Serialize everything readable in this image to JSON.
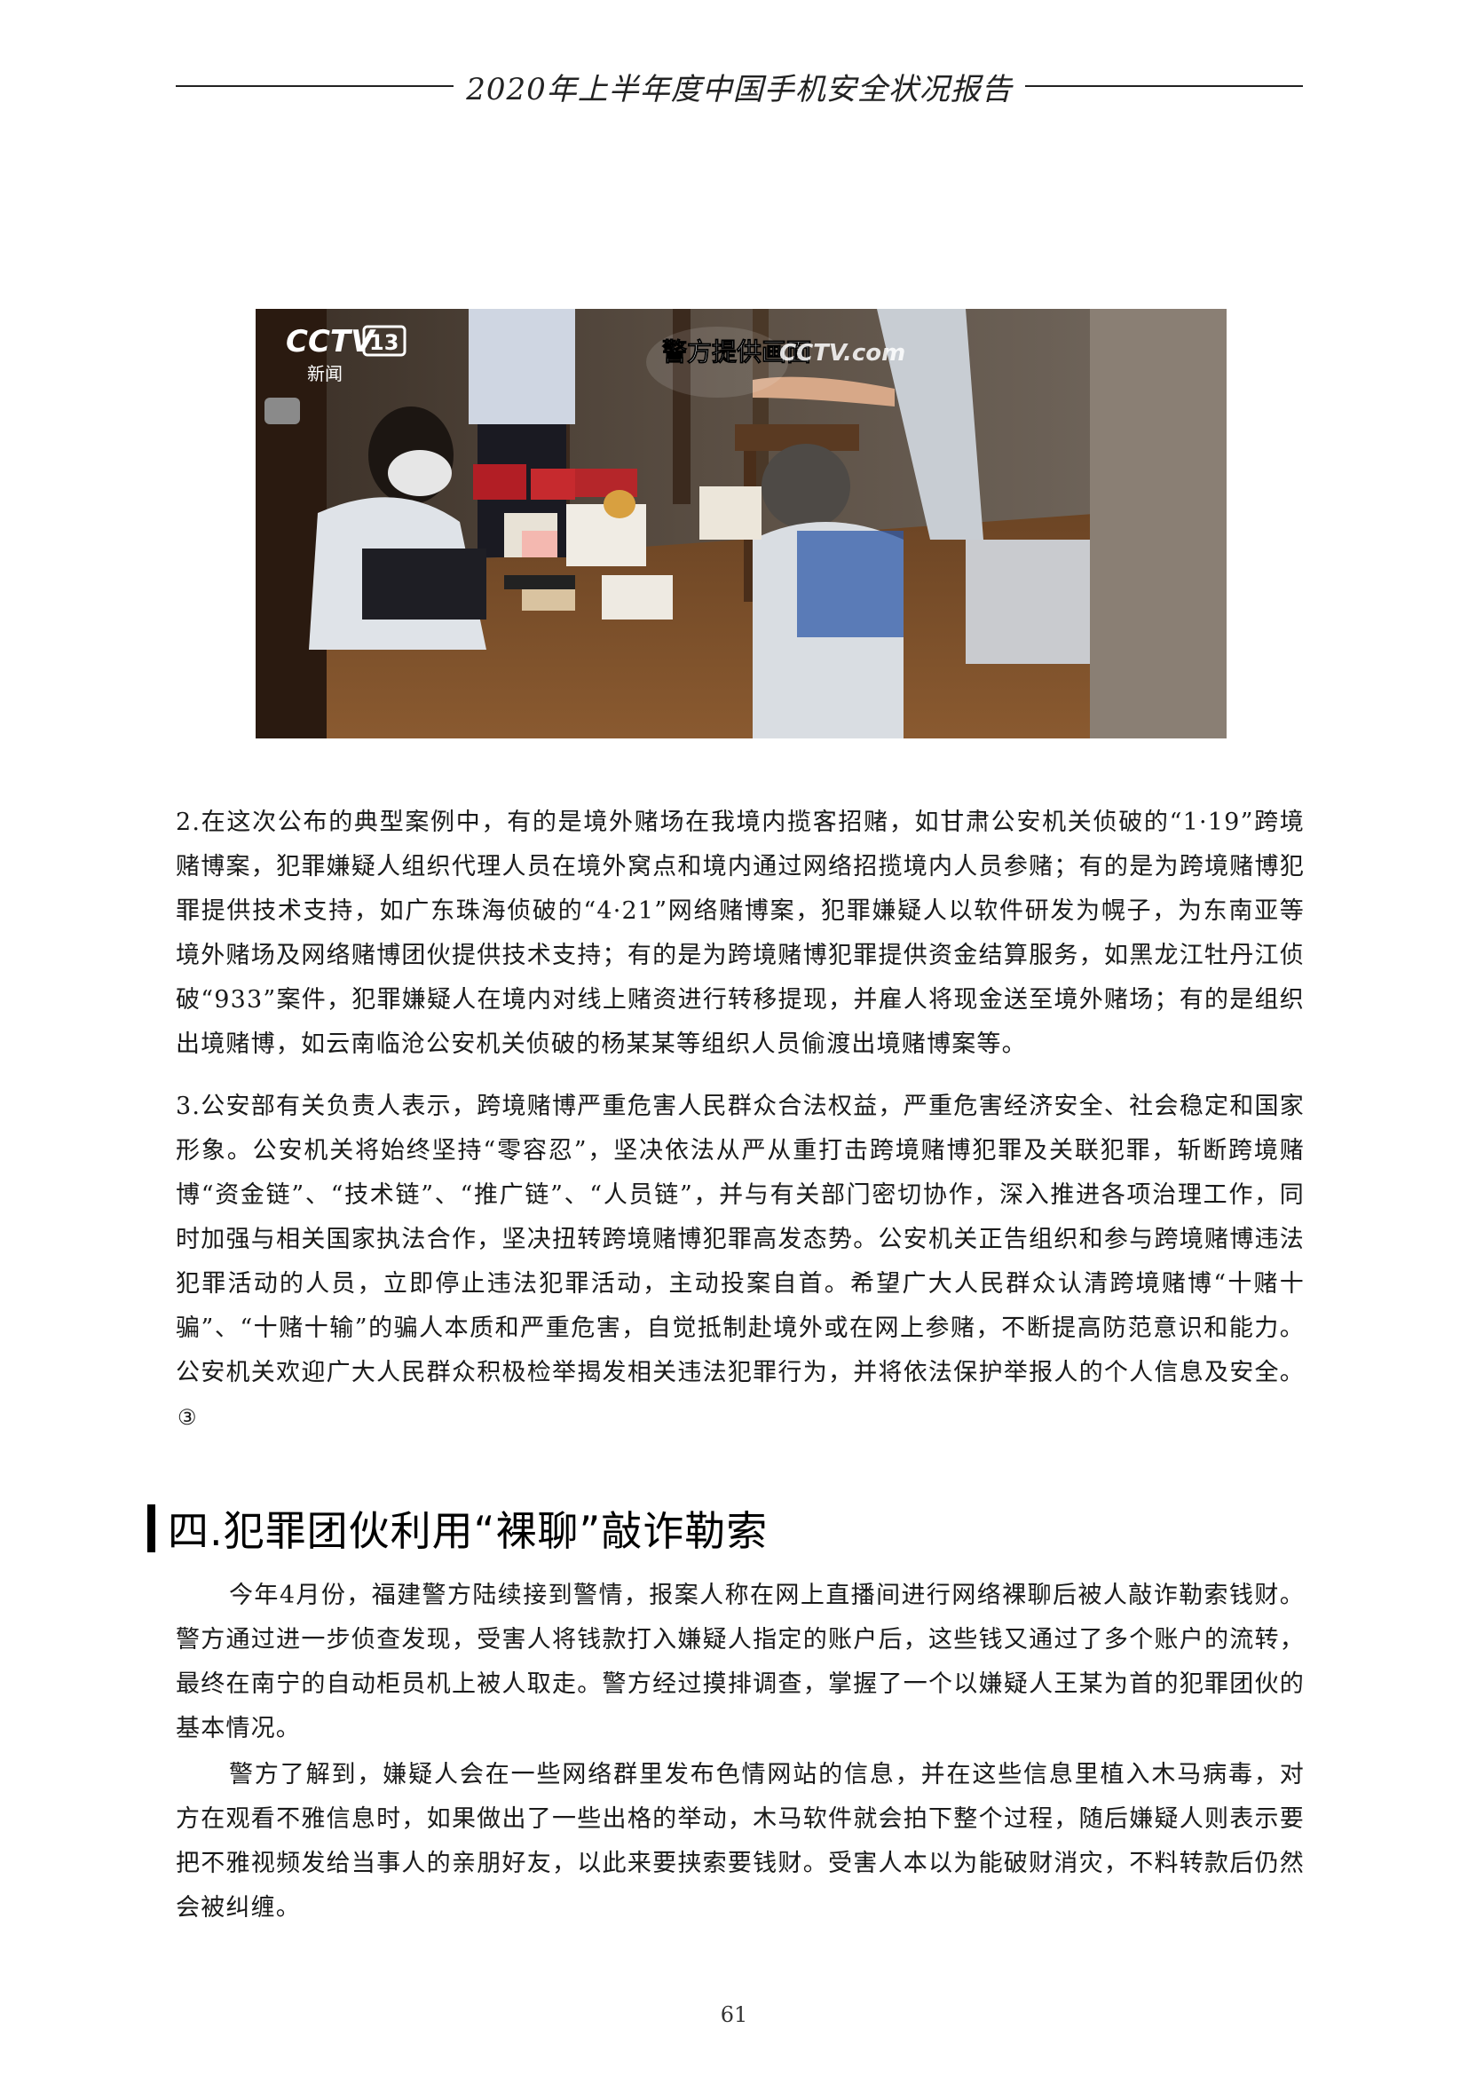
{
  "header": {
    "title": "2020年上半年度中国手机安全状况报告"
  },
  "photo": {
    "logo_text": "CCTV",
    "channel_number": "13",
    "channel_name": "新闻",
    "caption": "警方提供画面",
    "watermark": "CCTV.com"
  },
  "paragraphs": {
    "p2": "2.在这次公布的典型案例中，有的是境外赌场在我境内揽客招赌，如甘肃公安机关侦破的“1·19”跨境赌博案，犯罪嫌疑人组织代理人员在境外窝点和境内通过网络招揽境内人员参赌；有的是为跨境赌博犯罪提供技术支持，如广东珠海侦破的“4·21”网络赌博案，犯罪嫌疑人以软件研发为幌子，为东南亚等境外赌场及网络赌博团伙提供技术支持；有的是为跨境赌博犯罪提供资金结算服务，如黑龙江牡丹江侦破“933”案件，犯罪嫌疑人在境内对线上赌资进行转移提现，并雇人将现金送至境外赌场；有的是组织出境赌博，如云南临沧公安机关侦破的杨某某等组织人员偷渡出境赌博案等。",
    "p3": "3.公安部有关负责人表示，跨境赌博严重危害人民群众合法权益，严重危害经济安全、社会稳定和国家形象。公安机关将始终坚持“零容忍”，坚决依法从严从重打击跨境赌博犯罪及关联犯罪，斩断跨境赌博“资金链”、“技术链”、“推广链”、“人员链”，并与有关部门密切协作，深入推进各项治理工作，同时加强与相关国家执法合作，坚决扭转跨境赌博犯罪高发态势。公安机关正告组织和参与跨境赌博违法犯罪活动的人员，立即停止违法犯罪活动，主动投案自首。希望广大人民群众认清跨境赌博“十赌十骗”、“十赌十输”的骗人本质和严重危害，自觉抵制赴境外或在网上参赌，不断提高防范意识和能力。公安机关欢迎广大人民群众积极检举揭发相关违法犯罪行为，并将依法保护举报人的个人信息及安全。",
    "p3_footnote": "③"
  },
  "section": {
    "heading": "四.犯罪团伙利用“裸聊”敲诈勒索"
  },
  "body": {
    "p1": "今年4月份，福建警方陆续接到警情，报案人称在网上直播间进行网络裸聊后被人敲诈勒索钱财。警方通过进一步侦查发现，受害人将钱款打入嫌疑人指定的账户后，这些钱又通过了多个账户的流转，最终在南宁的自动柜员机上被人取走。警方经过摸排调查，掌握了一个以嫌疑人王某为首的犯罪团伙的基本情况。",
    "p2": "警方了解到，嫌疑人会在一些网络群里发布色情网站的信息，并在这些信息里植入木马病毒，对方在观看不雅信息时，如果做出了一些出格的举动，木马软件就会拍下整个过程，随后嫌疑人则表示要把不雅视频发给当事人的亲朋好友，以此来要挟索要钱财。受害人本以为能破财消灾，不料转款后仍然会被纠缠。"
  },
  "footer": {
    "page_number": "61"
  }
}
